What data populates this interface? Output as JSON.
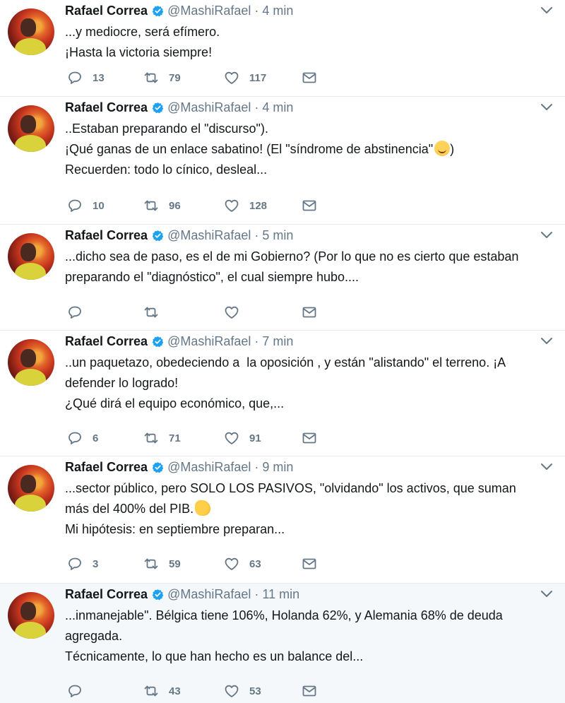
{
  "tweets": [
    {
      "name": "Rafael Correa",
      "handle": "@MashiRafael",
      "separator": "·",
      "time": "4 min",
      "lines": [
        "...y mediocre, será efímero.",
        "¡Hasta la victoria siempre!"
      ],
      "replies": "13",
      "retweets": "79",
      "likes": "117",
      "highlight": false
    },
    {
      "name": "Rafael Correa",
      "handle": "@MashiRafael",
      "separator": "·",
      "time": "4 min",
      "lines": [
        "..Estaban preparando el \"discurso\").",
        "¡Qué ganas de un enlace sabatino! (El \"síndrome de abstinencia\"",
        "Recuerden: todo lo cínico, desleal..."
      ],
      "line2_suffix": ")",
      "replies": "10",
      "retweets": "96",
      "likes": "128",
      "highlight": false
    },
    {
      "name": "Rafael Correa",
      "handle": "@MashiRafael",
      "separator": "·",
      "time": "5 min",
      "lines": [
        "...dicho sea de paso, es el de mi Gobierno? (Por lo que no es cierto que estaban",
        "preparando el \"diagnóstico\", el cual siempre hubo...."
      ],
      "replies": "",
      "retweets": "",
      "likes": "",
      "highlight": false
    },
    {
      "name": "Rafael Correa",
      "handle": "@MashiRafael",
      "separator": "·",
      "time": "7 min",
      "lines": [
        "..un paquetazo, obedeciendo a  la oposición , y están \"alistando\" el terreno. ¡A",
        "defender lo logrado!",
        "¿Qué dirá el equipo económico, que,..."
      ],
      "replies": "6",
      "retweets": "71",
      "likes": "91",
      "highlight": false
    },
    {
      "name": "Rafael Correa",
      "handle": "@MashiRafael",
      "separator": "·",
      "time": "9 min",
      "lines": [
        "...sector público, pero SOLO LOS PASIVOS, \"olvidando\" los activos, que suman",
        "más del 400% del PIB.",
        "Mi hipótesis: en septiembre preparan..."
      ],
      "replies": "3",
      "retweets": "59",
      "likes": "63",
      "highlight": false
    },
    {
      "name": "Rafael Correa",
      "handle": "@MashiRafael",
      "separator": "·",
      "time": "11 min",
      "lines": [
        "...inmanejable\". Bélgica tiene 106%, Holanda 62%, y Alemania 68% de deuda",
        "agregada.",
        "Técnicamente, lo que han hecho es un balance del..."
      ],
      "replies": "",
      "retweets": "43",
      "likes": "53",
      "highlight": true
    }
  ],
  "colors": {
    "text": "#14171a",
    "secondary": "#657786",
    "verified": "#1da1f2",
    "divider": "#e6ecf0",
    "highlight_bg": "#f5f8fa"
  },
  "icons": [
    "reply-icon",
    "retweet-icon",
    "like-icon",
    "direct-message-icon",
    "verified-badge-icon",
    "chevron-down-icon"
  ]
}
